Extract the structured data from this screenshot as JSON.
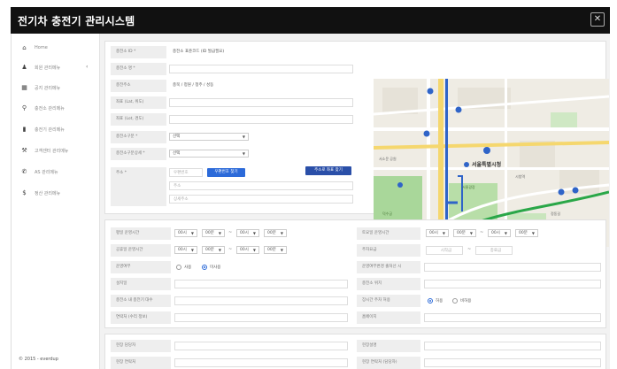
{
  "window": {
    "title": "전기차 충전기 관리시스템",
    "close_glyph": "✕"
  },
  "sidebar": {
    "items": [
      {
        "icon": "home-icon",
        "glyph": "⌂",
        "label": "Home"
      },
      {
        "icon": "user-icon",
        "glyph": "♟",
        "label": "회원 관리메뉴",
        "chevron": "‹"
      },
      {
        "icon": "board-icon",
        "glyph": "▦",
        "label": "공지 관리메뉴"
      },
      {
        "icon": "marker-icon",
        "glyph": "⚲",
        "label": "충전소 관리메뉴"
      },
      {
        "icon": "charger-icon",
        "glyph": "▮",
        "label": "충전기 관리메뉴"
      },
      {
        "icon": "tool-icon",
        "glyph": "⚒",
        "label": "고객센터 관리메뉴"
      },
      {
        "icon": "phone-icon",
        "glyph": "✆",
        "label": "AS 관리메뉴"
      },
      {
        "icon": "dollar-icon",
        "glyph": "$",
        "label": "정산 관리메뉴"
      }
    ],
    "footer": "© 2015 - everdup"
  },
  "station_form": {
    "rows": [
      {
        "label": "충전소 ID *",
        "value": "충전소 표준코드 (ID 발급필요)"
      },
      {
        "label": "충전소 명 *",
        "value": ""
      },
      {
        "label": "충전주소",
        "value": "충북 / 청원 / 청주 / 성동"
      },
      {
        "label": "좌표 (Lat, 위도)",
        "value": ""
      },
      {
        "label": "좌표 (Lot, 경도)",
        "value": ""
      },
      {
        "label": "충전소구분 *",
        "value": "선택",
        "type": "select"
      },
      {
        "label": "충전소구분상세 *",
        "value": "선택",
        "type": "select"
      },
      {
        "label": "주소 *",
        "value": ""
      }
    ],
    "postcode_placeholder": "우편번호",
    "find_postcode_button": "우편번호 찾기",
    "map_locate_button": "주소로 좌표 찾기",
    "address_placeholder": "주소",
    "address_detail_placeholder": "상세주소"
  },
  "map": {
    "labels": [
      "서울특별시청",
      "서소문 공원",
      "서울광장",
      "시청역",
      "덕수궁",
      "정동길"
    ]
  },
  "detail_form": {
    "left_rows": [
      {
        "label": "평일 운영시간"
      },
      {
        "label": "공휴일 운영시간"
      },
      {
        "label": "운영여부"
      },
      {
        "label": "설치일"
      },
      {
        "label": "충전소 내 충전기 대수"
      },
      {
        "label": "연락처 (수리 정보)"
      }
    ],
    "right_rows": [
      {
        "label": "토요일 운영시간"
      },
      {
        "label": "주차요금"
      },
      {
        "label": "운영여부변경 출처선 시"
      },
      {
        "label": "충전소 위치"
      },
      {
        "label": "장시간 주차 허용"
      },
      {
        "label": "홈페이지"
      }
    ],
    "hour_select": "00시",
    "min_select": "00분",
    "tilde": "~",
    "radio_operate": {
      "off": "사용",
      "on": "미사용"
    },
    "radio_parking": {
      "on": "허용",
      "off": "비허용"
    },
    "fee_from": "시작금",
    "fee_to": "종료금"
  },
  "bottom_form": {
    "rows": [
      {
        "label": "현장 담당자",
        "right_label": "현장설명"
      },
      {
        "label": "현장 연락처",
        "right_label": "현장 연락처 (담당자)"
      }
    ]
  }
}
